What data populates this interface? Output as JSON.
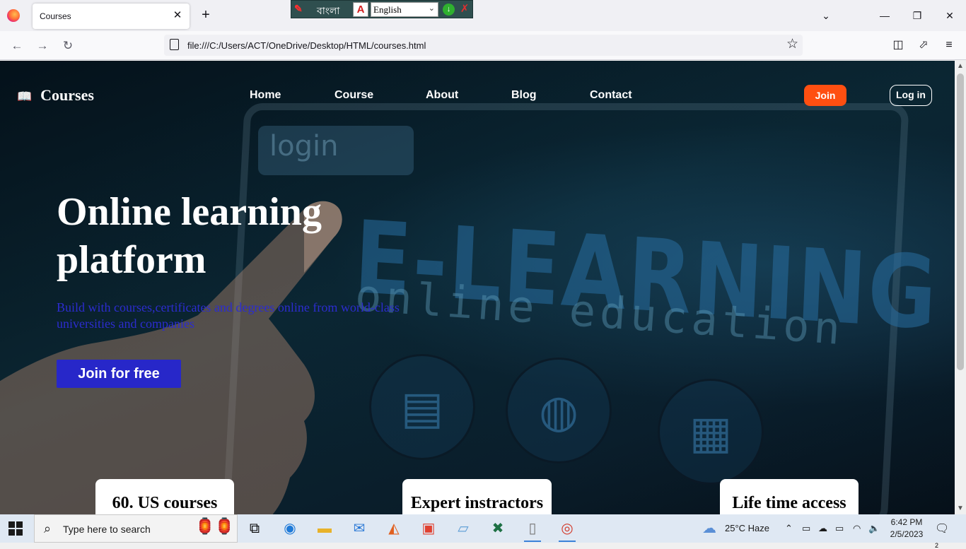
{
  "browser": {
    "tab_title": "Courses",
    "tab_close": "✕",
    "new_tab": "+",
    "url": "file:///C:/Users/ACT/OneDrive/Desktop/HTML/courses.html",
    "ime": {
      "script_label": "বাংলা",
      "adobe_label": "A",
      "language": "English"
    },
    "window_controls": {
      "list": "⌄",
      "minimize": "—",
      "restore": "❐",
      "close": "✕"
    },
    "nav_icons": {
      "back": "←",
      "forward": "→",
      "reload": "↻",
      "star": "☆",
      "pocket": "◫",
      "extensions": "⬀",
      "menu": "≡"
    }
  },
  "site": {
    "logo_icon": "book-icon",
    "logo_text": "Courses",
    "menu": [
      "Home",
      "Course",
      "About",
      "Blog",
      "Contact"
    ],
    "join_label": "Join",
    "login_label": "Log in",
    "accent_color": "#ff4f11",
    "primary_color": "#2727c9"
  },
  "hero": {
    "title": "Online learning platform",
    "subtitle": "Build with courses,certificates and degrees online from world-class universities and companies",
    "cta_label": "Join for free"
  },
  "background_text": {
    "login": "login",
    "headline": "E-LEARNING",
    "sub": "online education"
  },
  "features": [
    "60. US courses",
    "Expert instractors",
    "Life time access"
  ],
  "taskbar": {
    "search_placeholder": "Type here to search",
    "weather": "25°C  Haze",
    "time": "6:42 PM",
    "date": "2/5/2023",
    "notification_count": "2"
  }
}
